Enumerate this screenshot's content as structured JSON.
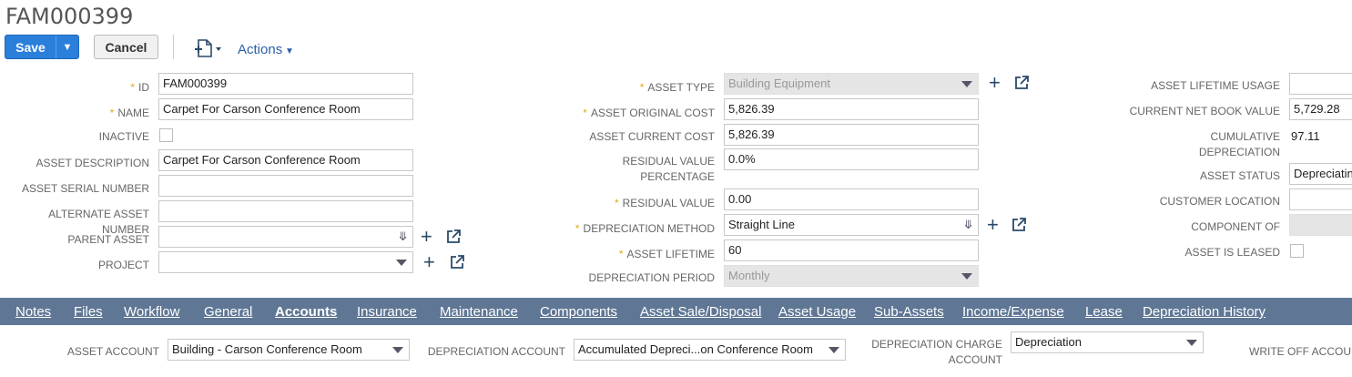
{
  "page": {
    "title": "FAM000399"
  },
  "toolbar": {
    "save_label": "Save",
    "cancel_label": "Cancel",
    "actions_label": "Actions"
  },
  "col1": {
    "id_label": "ID",
    "id_value": "FAM000399",
    "name_label": "NAME",
    "name_value": "Carpet For Carson Conference Room",
    "inactive_label": "INACTIVE",
    "desc_label": "ASSET DESCRIPTION",
    "desc_value": "Carpet For Carson Conference Room",
    "serial_label": "ASSET SERIAL NUMBER",
    "alt_label": "ALTERNATE ASSET NUMBER",
    "parent_label": "PARENT ASSET",
    "project_label": "PROJECT"
  },
  "col2": {
    "type_label": "ASSET TYPE",
    "type_value": "Building Equipment",
    "orig_cost_label": "ASSET ORIGINAL COST",
    "orig_cost_value": "5,826.39",
    "cur_cost_label": "ASSET CURRENT COST",
    "cur_cost_value": "5,826.39",
    "residual_pct_label_1": "RESIDUAL VALUE",
    "residual_pct_label_2": "PERCENTAGE",
    "residual_pct_value": "0.0%",
    "residual_label": "RESIDUAL VALUE",
    "residual_value": "0.00",
    "method_label": "DEPRECIATION METHOD",
    "method_value": "Straight Line",
    "lifetime_label": "ASSET LIFETIME",
    "lifetime_value": "60",
    "period_label": "DEPRECIATION PERIOD",
    "period_value": "Monthly"
  },
  "col3": {
    "lifetime_usage_label": "ASSET LIFETIME USAGE",
    "nbv_label": "CURRENT NET BOOK VALUE",
    "nbv_value": "5,729.28",
    "cum_dep_label_1": "CUMULATIVE",
    "cum_dep_label_2": "DEPRECIATION",
    "cum_dep_value": "97.11",
    "status_label": "ASSET STATUS",
    "status_value": "Depreciating",
    "customer_label": "CUSTOMER LOCATION",
    "component_label": "COMPONENT OF",
    "leased_label": "ASSET IS LEASED"
  },
  "tabs": [
    "Notes",
    "Files",
    "Workflow",
    "General",
    "Accounts",
    "Insurance",
    "Maintenance",
    "Components",
    "Asset Sale/Disposal",
    "Asset Usage",
    "Sub-Assets",
    "Income/Expense",
    "Lease",
    "Depreciation History"
  ],
  "accounts": {
    "asset_account_label": "ASSET ACCOUNT",
    "asset_account_value": "Building - Carson Conference Room",
    "dep_account_label": "DEPRECIATION ACCOUNT",
    "dep_account_value": "Accumulated Depreci...on Conference Room",
    "dep_charge_label_1": "DEPRECIATION CHARGE",
    "dep_charge_label_2": "ACCOUNT",
    "dep_charge_value": "Depreciation",
    "write_off_label": "WRITE OFF ACCOUNT"
  },
  "colors": {
    "primary": "#2a7fdb",
    "tabbar": "#5f7795",
    "required_star": "#e6a817"
  }
}
